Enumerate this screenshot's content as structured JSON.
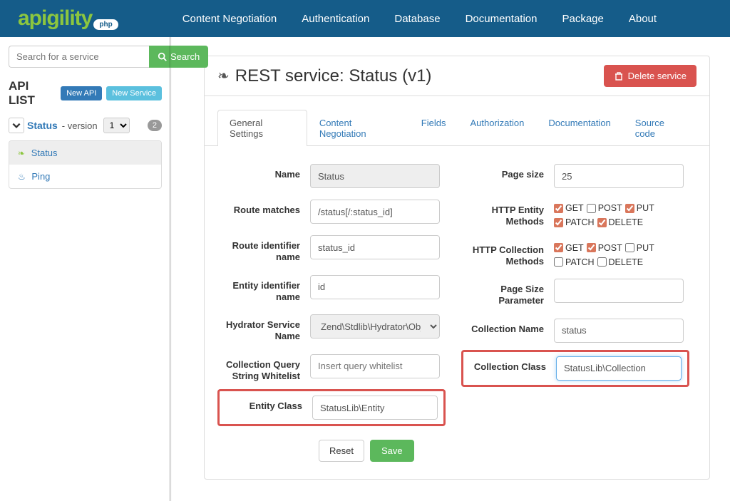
{
  "logo": {
    "text": "apigility",
    "pill": "php"
  },
  "nav": [
    "Content Negotiation",
    "Authentication",
    "Database",
    "Documentation",
    "Package",
    "About"
  ],
  "sidebar": {
    "search_placeholder": "Search for a service",
    "search_button": "Search",
    "list_title": "API LIST",
    "new_api": "New API",
    "new_service": "New Service",
    "api_name": "Status",
    "version_label": "- version",
    "version_value": "1",
    "service_count": "2",
    "services": [
      {
        "name": "Status",
        "selected": true,
        "icon": "leaf"
      },
      {
        "name": "Ping",
        "selected": false,
        "icon": "fire"
      }
    ]
  },
  "main": {
    "title": "REST service: Status (v1)",
    "delete_label": "Delete service",
    "tabs": [
      "General Settings",
      "Content Negotiation",
      "Fields",
      "Authorization",
      "Documentation",
      "Source code"
    ],
    "active_tab": 0,
    "left": {
      "name": {
        "label": "Name",
        "value": "Status"
      },
      "route_matches": {
        "label": "Route matches",
        "value": "/status[/:status_id]"
      },
      "route_ident": {
        "label": "Route identifier name",
        "value": "status_id"
      },
      "entity_ident": {
        "label": "Entity identifier name",
        "value": "id"
      },
      "hydrator": {
        "label": "Hydrator Service Name",
        "value": "Zend\\Stdlib\\Hydrator\\ObjectProperty"
      },
      "query_whitelist": {
        "label": "Collection Query String Whitelist",
        "placeholder": "Insert query whitelist"
      },
      "entity_class": {
        "label": "Entity Class",
        "value": "StatusLib\\Entity"
      }
    },
    "right": {
      "page_size": {
        "label": "Page size",
        "value": "25"
      },
      "entity_methods": {
        "label": "HTTP Entity Methods",
        "options": [
          {
            "name": "GET",
            "checked": true
          },
          {
            "name": "POST",
            "checked": false
          },
          {
            "name": "PUT",
            "checked": true
          },
          {
            "name": "PATCH",
            "checked": true
          },
          {
            "name": "DELETE",
            "checked": true
          }
        ]
      },
      "collection_methods": {
        "label": "HTTP Collection Methods",
        "options": [
          {
            "name": "GET",
            "checked": true
          },
          {
            "name": "POST",
            "checked": true
          },
          {
            "name": "PUT",
            "checked": false
          },
          {
            "name": "PATCH",
            "checked": false
          },
          {
            "name": "DELETE",
            "checked": false
          }
        ]
      },
      "page_size_param": {
        "label": "Page Size Parameter",
        "value": ""
      },
      "collection_name": {
        "label": "Collection Name",
        "value": "status"
      },
      "collection_class": {
        "label": "Collection Class",
        "value": "StatusLib\\Collection"
      }
    },
    "buttons": {
      "reset": "Reset",
      "save": "Save"
    }
  }
}
